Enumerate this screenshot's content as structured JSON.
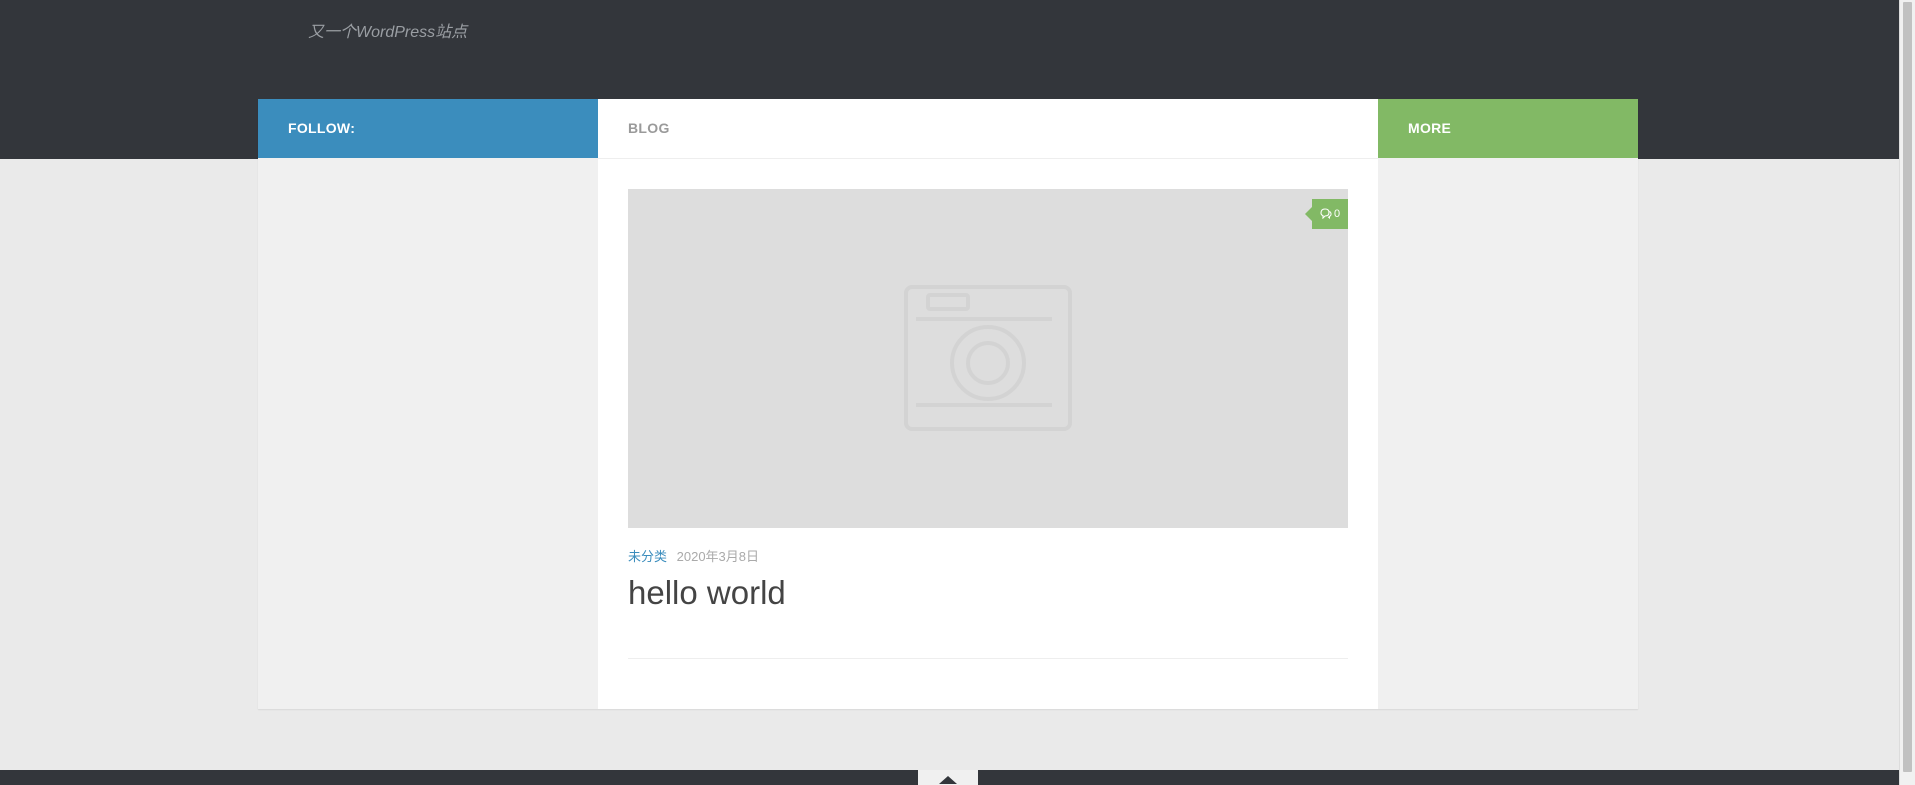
{
  "site": {
    "tagline": "又一个WordPress站点"
  },
  "columns": {
    "follow_label": "FOLLOW:",
    "blog_label": "BLOG",
    "more_label": "MORE"
  },
  "post": {
    "comment_count": "0",
    "category": "未分类",
    "date": "2020年3月8日",
    "title": "hello world"
  },
  "colors": {
    "header_bg": "#33363b",
    "follow_blue": "#3b8dbd",
    "more_green": "#82b965",
    "page_bg": "#eaeaea"
  },
  "icons": {
    "comment": "comments-icon",
    "thumbnail_placeholder": "camera-icon",
    "back_to_top": "chevron-up-icon"
  }
}
